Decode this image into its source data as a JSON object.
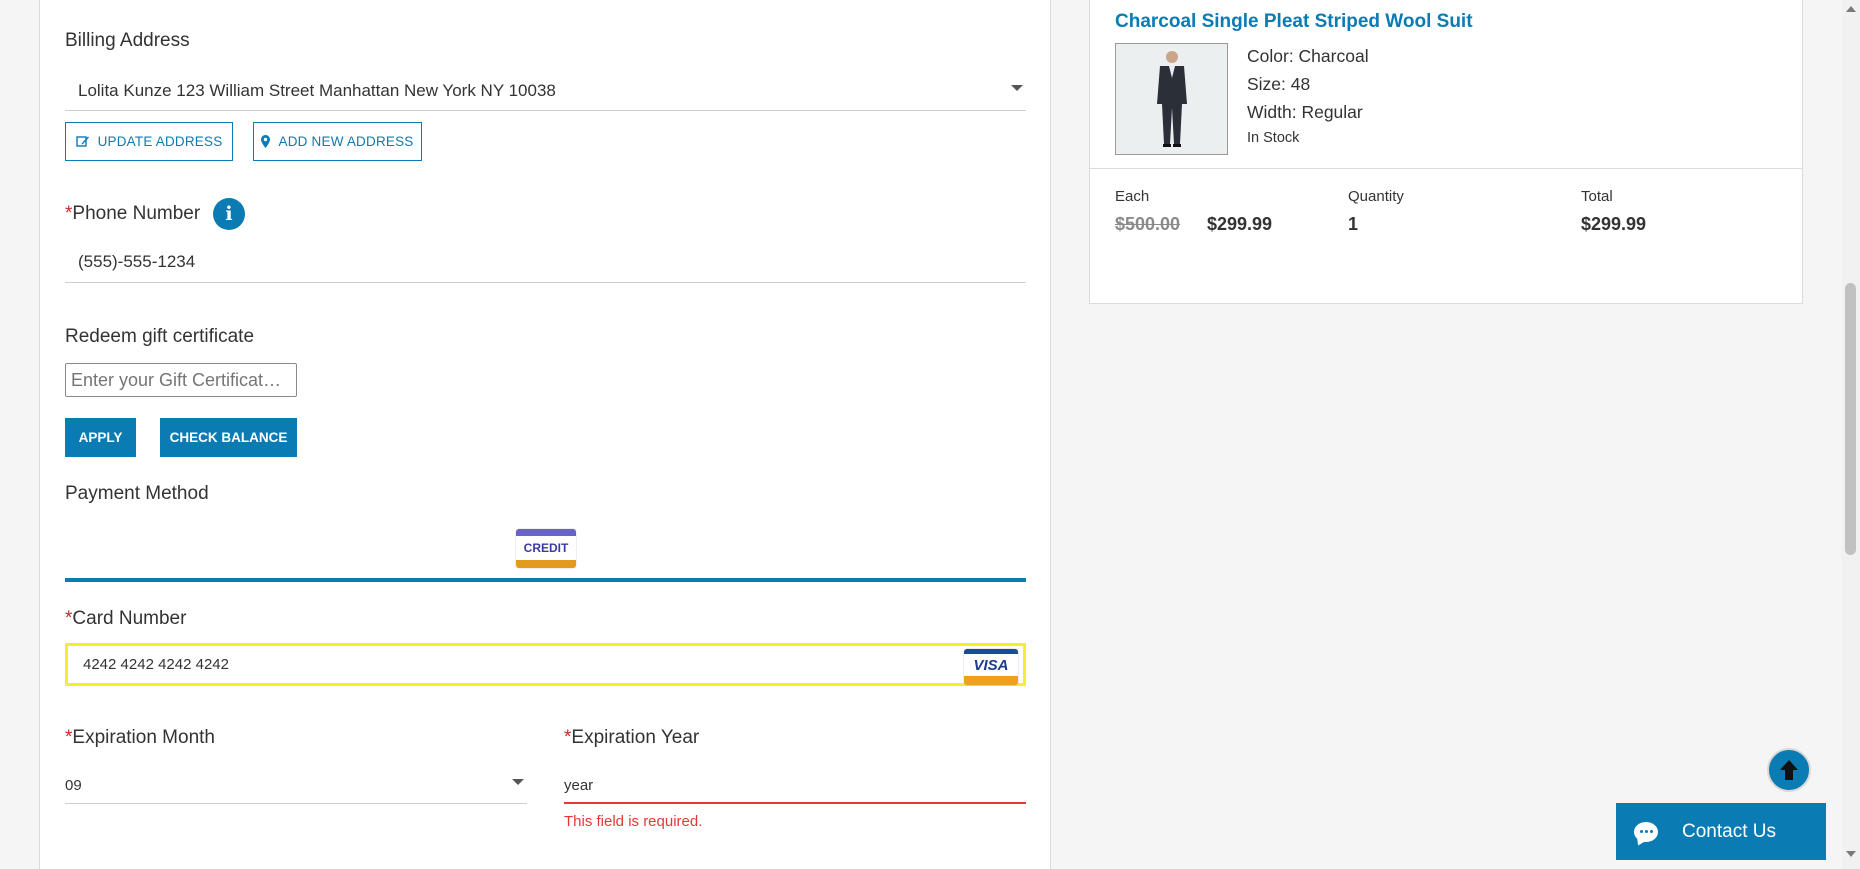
{
  "billing": {
    "heading": "Billing Address",
    "selected_address": "Lolita Kunze 123 William Street Manhattan New York NY 10038",
    "update_label": "UPDATE ADDRESS",
    "add_label": "ADD NEW ADDRESS"
  },
  "phone": {
    "required_mark": "*",
    "label": "Phone Number",
    "info_icon": "i",
    "value": "(555)-555-1234"
  },
  "gift": {
    "heading": "Redeem gift certificate",
    "placeholder": "Enter your Gift Certificat…",
    "apply_label": "APPLY",
    "check_label": "CHECK BALANCE"
  },
  "payment": {
    "heading": "Payment Method",
    "tab_label": "CREDIT",
    "card_required": "*",
    "card_label": "Card Number",
    "card_value": "4242 4242 4242 4242",
    "card_brand": "VISA",
    "month_required": "*",
    "month_label": "Expiration Month",
    "month_value": "09",
    "year_required": "*",
    "year_label": "Expiration Year",
    "year_value": "year",
    "year_error": "This field is required."
  },
  "product": {
    "title": "Charcoal Single Pleat Striped Wool Suit",
    "color": "Color: Charcoal",
    "size": "Size: 48",
    "width": "Width: Regular",
    "stock": "In Stock",
    "each_label": "Each",
    "quantity_label": "Quantity",
    "total_label": "Total",
    "original_price": "$500.00",
    "sale_price": "$299.99",
    "quantity": "1",
    "total": "$299.99"
  },
  "contact": {
    "label": "Contact Us"
  },
  "colors": {
    "accent": "#0b7bb3",
    "error": "#e53935",
    "highlight": "#f2ef2d"
  }
}
